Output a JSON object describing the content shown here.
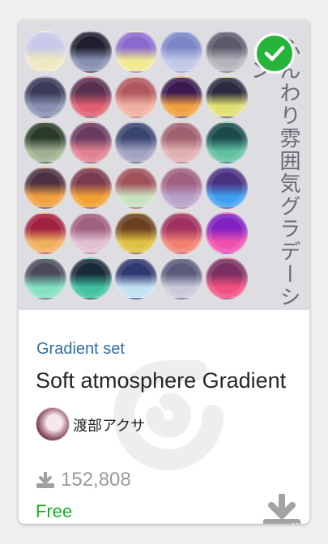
{
  "card": {
    "category": "Gradient set",
    "title": "Soft atmosphere Gradient",
    "author": "渡部アクサ",
    "downloads": "152,808",
    "price": "Free"
  },
  "thumbnail": {
    "vertical_text": "ふんわり雰囲気グラデーション",
    "swatches": [
      [
        [
          "#c8c8ea",
          "#f0e8c0"
        ],
        [
          "#1e1e2e",
          "#8890b0"
        ],
        [
          "#8a6ad0",
          "#f0e890"
        ],
        [
          "#7a86c6",
          "#c0c8e6"
        ],
        [
          "#5a5a6a",
          "#b4b4bc"
        ]
      ],
      [
        [
          "#3a3a5a",
          "#8a90b0"
        ],
        [
          "#5a3050",
          "#e06070"
        ],
        [
          "#b05860",
          "#f0b0a0"
        ],
        [
          "#3a1a50",
          "#f0a040"
        ],
        [
          "#2a2a40",
          "#e0e070"
        ]
      ],
      [
        [
          "#2a3a2a",
          "#a0b090"
        ],
        [
          "#6a3a60",
          "#e08090"
        ],
        [
          "#3a4670",
          "#a0a0c0"
        ],
        [
          "#a06070",
          "#e0b0b0"
        ],
        [
          "#1a4a4a",
          "#60c0a0"
        ]
      ],
      [
        [
          "#4a3040",
          "#f0a040"
        ],
        [
          "#7a3a50",
          "#f0a030"
        ],
        [
          "#a05058",
          "#c8e0c0"
        ],
        [
          "#a06080",
          "#b8a0c8"
        ],
        [
          "#4a3080",
          "#40a0f0"
        ]
      ],
      [
        [
          "#a02040",
          "#f0b060"
        ],
        [
          "#a06080",
          "#e0c0d0"
        ],
        [
          "#6a4020",
          "#e0c040"
        ],
        [
          "#a03060",
          "#f08070"
        ],
        [
          "#8020c0",
          "#f050b0"
        ]
      ],
      [
        [
          "#4a4a5a",
          "#80e0c0"
        ],
        [
          "#1a2a3a",
          "#40c0a0"
        ],
        [
          "#303870",
          "#c0e0f0"
        ],
        [
          "#5a5a7a",
          "#c8c8d8"
        ],
        [
          "#7a3060",
          "#f05080"
        ]
      ]
    ]
  },
  "icons": {
    "check": "check-icon",
    "watermark": "logo-watermark-icon",
    "download_small": "download-icon",
    "download_button": "download-icon"
  },
  "colors": {
    "category": "#2f6fa3",
    "price": "#18b328",
    "check_badge": "#27b43a",
    "muted": "#9a9a9a"
  }
}
